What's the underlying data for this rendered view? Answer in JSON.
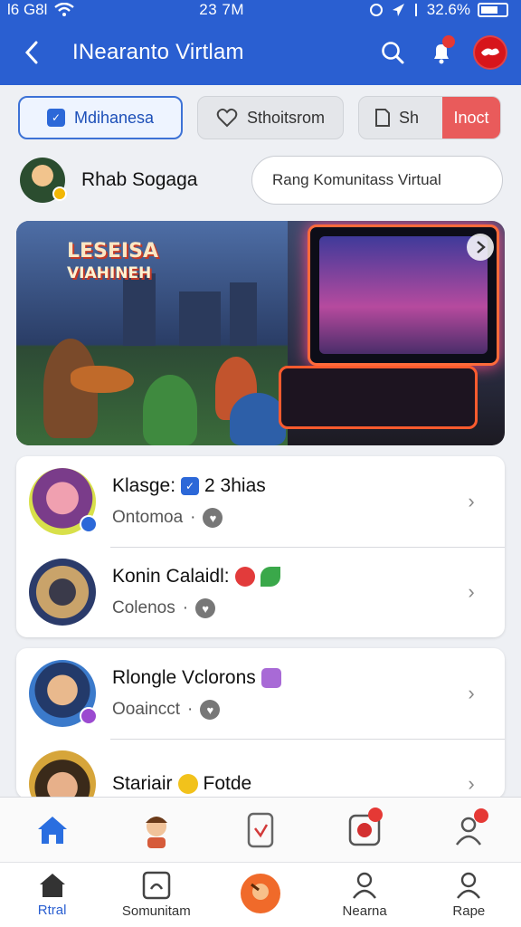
{
  "status_bar": {
    "carrier": "l6 G8l",
    "time": "23 7M",
    "battery": "32.6%"
  },
  "header": {
    "title": "INearanto Virtlam",
    "back_icon": "chevron-left-icon",
    "search_icon": "search-icon",
    "notification_icon": "bell-icon"
  },
  "chips": {
    "chip_a": "Mdihanesa",
    "chip_b": "Sthoitsrom",
    "chip_c_count": "Sh",
    "chip_c_action": "Inoct"
  },
  "user": {
    "name": "Rhab Sogaga",
    "search_placeholder": "Rang Komunitass Virtual"
  },
  "banner": {
    "headline_1": "LESEISA",
    "headline_2": "VIAHINEH"
  },
  "list": [
    {
      "title": "Klasge:",
      "title_extra": "2 3hias",
      "subtitle": "Ontomoa",
      "sep": "·"
    },
    {
      "title": "Konin Calaidl:",
      "title_extra": "",
      "subtitle": "Colenos",
      "sep": "·"
    },
    {
      "title": "Rlongle Vclorons",
      "title_extra": "",
      "subtitle": "Ooaincct",
      "sep": "·"
    },
    {
      "title": "Stariair",
      "title_extra": "Fotde",
      "subtitle": "",
      "sep": ""
    }
  ],
  "bottom_nav": [
    {
      "label": "Rtral",
      "icon": "home-icon",
      "active": true
    },
    {
      "label": "Somunitam",
      "icon": "community-icon",
      "active": false
    },
    {
      "label": "",
      "icon": "create-icon",
      "active": false
    },
    {
      "label": "Nearna",
      "icon": "profile-icon",
      "active": false
    },
    {
      "label": "Rape",
      "icon": "account-icon",
      "active": false
    }
  ],
  "colors": {
    "primary": "#2a5fd1",
    "accent_red": "#e95b5b",
    "badge_red": "#e53935"
  }
}
